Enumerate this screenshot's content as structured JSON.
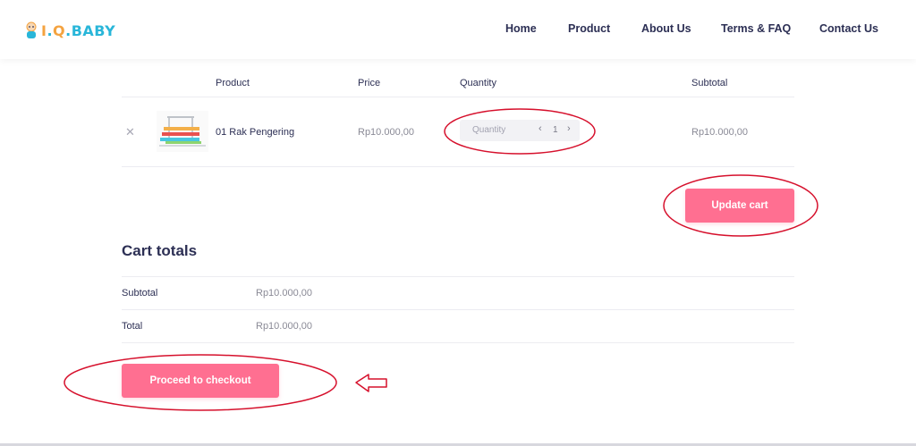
{
  "brand": {
    "name": "I.Q.BABY",
    "colors": {
      "primary": "#2c2f54",
      "accent": "#ff6f91",
      "logo_blue": "#29b6d9",
      "logo_orange": "#f4a340",
      "annotation": "#d6102c"
    }
  },
  "nav": {
    "items": [
      {
        "label": "Home"
      },
      {
        "label": "Product"
      },
      {
        "label": "About Us"
      },
      {
        "label": "Terms & FAQ"
      },
      {
        "label": "Contact Us"
      }
    ]
  },
  "cart": {
    "headers": {
      "product": "Product",
      "price": "Price",
      "quantity": "Quantity",
      "subtotal": "Subtotal"
    },
    "items": [
      {
        "remove_icon": "close-icon",
        "thumbnail": "drying-rack-image",
        "name": "01 Rak Pengering",
        "price": "Rp10.000,00",
        "quantity_placeholder": "Quantity",
        "quantity": "1",
        "subtotal": "Rp10.000,00"
      }
    ],
    "update_button": "Update cart"
  },
  "totals": {
    "title": "Cart totals",
    "rows": [
      {
        "label": "Subtotal",
        "value": "Rp10.000,00"
      },
      {
        "label": "Total",
        "value": "Rp10.000,00"
      }
    ],
    "checkout_button": "Proceed to checkout"
  },
  "annotations": {
    "shapes": [
      "circle-quantity",
      "circle-update-cart",
      "circle-checkout",
      "arrow-pointing-left"
    ]
  }
}
